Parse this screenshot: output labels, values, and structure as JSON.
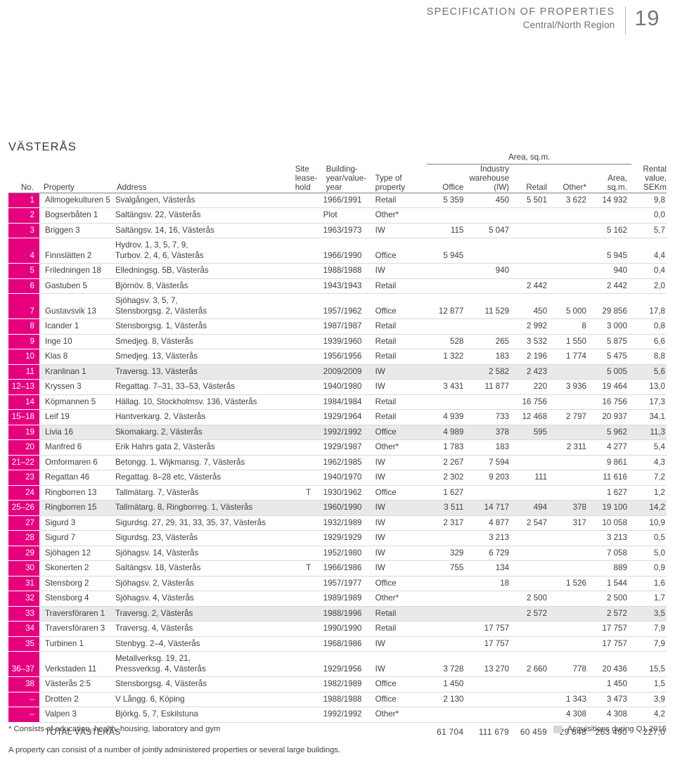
{
  "header": {
    "title": "SPECIFICATION OF PROPERTIES",
    "subtitle": "Central/North Region",
    "page_number": "19"
  },
  "city": "VÄSTERÅS",
  "table": {
    "group_header": "Area, sq.m.",
    "columns": {
      "no": "No.",
      "property": "Property",
      "address": "Address",
      "site_leasehold": "Site\nlease-\nhold",
      "building_year": "Building-\nyear/value-\nyear",
      "type_of_property": "Type of\nproperty",
      "office": "Office",
      "industry_warehouse": "Industry\nwarehouse\n(IW)",
      "retail": "Retail",
      "other": "Other*",
      "area_sqm": "Area,\nsq.m.",
      "rental_value": "Rental\nvalue,\nSEKm"
    },
    "rows": [
      {
        "no": "1",
        "property": "Allmogekulturen 5",
        "address": "Svalgången, Västerås",
        "address2": "",
        "site": "",
        "byear": "1966/1991",
        "type": "Retail",
        "office": "5 359",
        "iw": "450",
        "retail": "5 501",
        "other": "3 622",
        "area": "14 932",
        "rental": "9,8",
        "acq": false
      },
      {
        "no": "2",
        "property": "Bogserbåten 1",
        "address": "Saltängsv. 22, Västerås",
        "address2": "",
        "site": "",
        "byear": "Plot",
        "type": "Other*",
        "office": "",
        "iw": "",
        "retail": "",
        "other": "",
        "area": "",
        "rental": "0,0",
        "acq": false
      },
      {
        "no": "3",
        "property": "Briggen 3",
        "address": "Saltängsv. 14, 16, Västerås",
        "address2": "",
        "site": "",
        "byear": "1963/1973",
        "type": "IW",
        "office": "115",
        "iw": "5 047",
        "retail": "",
        "other": "",
        "area": "5 162",
        "rental": "5,7",
        "acq": false
      },
      {
        "no": "4",
        "property": "Finnslätten 2",
        "address": "Hydrov. 1, 3, 5, 7, 9,",
        "address2": "Turbov. 2, 4, 6, Västerås",
        "site": "",
        "byear": "1966/1990",
        "type": "Office",
        "office": "5 945",
        "iw": "",
        "retail": "",
        "other": "",
        "area": "5 945",
        "rental": "4,4",
        "acq": false
      },
      {
        "no": "5",
        "property": "Friledningen 18",
        "address": "Elledningsg. 5B, Västerås",
        "address2": "",
        "site": "",
        "byear": "1988/1988",
        "type": "IW",
        "office": "",
        "iw": "940",
        "retail": "",
        "other": "",
        "area": "940",
        "rental": "0,4",
        "acq": false
      },
      {
        "no": "6",
        "property": "Gastuben 5",
        "address": "Björnöv. 8, Västerås",
        "address2": "",
        "site": "",
        "byear": "1943/1943",
        "type": "Retail",
        "office": "",
        "iw": "",
        "retail": "2 442",
        "other": "",
        "area": "2 442",
        "rental": "2,0",
        "acq": false
      },
      {
        "no": "7",
        "property": "Gustavsvik 13",
        "address": "Sjöhagsv. 3, 5, 7,",
        "address2": "Stensborgsg. 2, Västerås",
        "site": "",
        "byear": "1957/1962",
        "type": "Office",
        "office": "12 877",
        "iw": "11 529",
        "retail": "450",
        "other": "5 000",
        "area": "29 856",
        "rental": "17,8",
        "acq": false
      },
      {
        "no": "8",
        "property": "Icander 1",
        "address": "Stensborgsg. 1, Västerås",
        "address2": "",
        "site": "",
        "byear": "1987/1987",
        "type": "Retail",
        "office": "",
        "iw": "",
        "retail": "2 992",
        "other": "8",
        "area": "3 000",
        "rental": "0,8",
        "acq": false
      },
      {
        "no": "9",
        "property": "Inge 10",
        "address": "Smedjeg. 8, Västerås",
        "address2": "",
        "site": "",
        "byear": "1939/1960",
        "type": "Retail",
        "office": "528",
        "iw": "265",
        "retail": "3 532",
        "other": "1 550",
        "area": "5 875",
        "rental": "6,6",
        "acq": false
      },
      {
        "no": "10",
        "property": "Klas 8",
        "address": "Smedjeg. 13, Västerås",
        "address2": "",
        "site": "",
        "byear": "1956/1956",
        "type": "Retail",
        "office": "1 322",
        "iw": "183",
        "retail": "2 196",
        "other": "1 774",
        "area": "5 475",
        "rental": "8,8",
        "acq": false
      },
      {
        "no": "11",
        "property": "Kranlinan 1",
        "address": "Traversg. 13, Västerås",
        "address2": "",
        "site": "",
        "byear": "2009/2009",
        "type": "IW",
        "office": "",
        "iw": "2 582",
        "retail": "2 423",
        "other": "",
        "area": "5 005",
        "rental": "5,6",
        "acq": true
      },
      {
        "no": "12–13",
        "property": "Kryssen 3",
        "address": "Regattag. 7–31, 33–53, Västerås",
        "address2": "",
        "site": "",
        "byear": "1940/1980",
        "type": "IW",
        "office": "3 431",
        "iw": "11 877",
        "retail": "220",
        "other": "3 936",
        "area": "19 464",
        "rental": "13,0",
        "acq": false
      },
      {
        "no": "14",
        "property": "Köpmannen 5",
        "address": "Hällag. 10, Stockholmsv. 136, Västerås",
        "address2": "",
        "site": "",
        "byear": "1984/1984",
        "type": "Retail",
        "office": "",
        "iw": "",
        "retail": "16 756",
        "other": "",
        "area": "16 756",
        "rental": "17,3",
        "acq": false
      },
      {
        "no": "15–18",
        "property": "Leif 19",
        "address": "Hantverkarg. 2, Västerås",
        "address2": "",
        "site": "",
        "byear": "1929/1964",
        "type": "Retail",
        "office": "4 939",
        "iw": "733",
        "retail": "12 468",
        "other": "2 797",
        "area": "20 937",
        "rental": "34,1",
        "acq": false
      },
      {
        "no": "19",
        "property": "Livia 16",
        "address": "Skomakarg. 2, Västerås",
        "address2": "",
        "site": "",
        "byear": "1992/1992",
        "type": "Office",
        "office": "4 989",
        "iw": "378",
        "retail": "595",
        "other": "",
        "area": "5 962",
        "rental": "11,3",
        "acq": true
      },
      {
        "no": "20",
        "property": "Manfred 6",
        "address": "Erik Hahrs gata 2, Västerås",
        "address2": "",
        "site": "",
        "byear": "1929/1987",
        "type": "Other*",
        "office": "1 783",
        "iw": "183",
        "retail": "",
        "other": "2 311",
        "area": "4 277",
        "rental": "5,4",
        "acq": false
      },
      {
        "no": "21–22",
        "property": "Omformaren 6",
        "address": "Betongg. 1, Wijkmansg. 7, Västerås",
        "address2": "",
        "site": "",
        "byear": "1962/1985",
        "type": "IW",
        "office": "2 267",
        "iw": "7 594",
        "retail": "",
        "other": "",
        "area": "9 861",
        "rental": "4,3",
        "acq": false
      },
      {
        "no": "23",
        "property": "Regattan 46",
        "address": "Regattag. 8–28 etc, Västerås",
        "address2": "",
        "site": "",
        "byear": "1940/1970",
        "type": "IW",
        "office": "2 302",
        "iw": "9 203",
        "retail": "111",
        "other": "",
        "area": "11 616",
        "rental": "7,2",
        "acq": false
      },
      {
        "no": "24",
        "property": "Ringborren 13",
        "address": "Tallmätarg. 7, Västerås",
        "address2": "",
        "site": "T",
        "byear": "1930/1962",
        "type": "Office",
        "office": "1 627",
        "iw": "",
        "retail": "",
        "other": "",
        "area": "1 627",
        "rental": "1,2",
        "acq": false
      },
      {
        "no": "25–26",
        "property": "Ringborren 15",
        "address": "Tallmätarg. 8, Ringborreg. 1, Västerås",
        "address2": "",
        "site": "",
        "byear": "1960/1990",
        "type": "IW",
        "office": "3 511",
        "iw": "14 717",
        "retail": "494",
        "other": "378",
        "area": "19 100",
        "rental": "14,2",
        "acq": true
      },
      {
        "no": "27",
        "property": "Sigurd 3",
        "address": "Sigurdsg. 27, 29, 31, 33, 35, 37, Västerås",
        "address2": "",
        "site": "",
        "byear": "1932/1989",
        "type": "IW",
        "office": "2 317",
        "iw": "4 877",
        "retail": "2 547",
        "other": "317",
        "area": "10 058",
        "rental": "10,9",
        "acq": false
      },
      {
        "no": "28",
        "property": "Sigurd 7",
        "address": "Sigurdsg. 23, Västerås",
        "address2": "",
        "site": "",
        "byear": "1929/1929",
        "type": "IW",
        "office": "",
        "iw": "3 213",
        "retail": "",
        "other": "",
        "area": "3 213",
        "rental": "0,5",
        "acq": false
      },
      {
        "no": "29",
        "property": "Sjöhagen 12",
        "address": "Sjöhagsv. 14, Västerås",
        "address2": "",
        "site": "",
        "byear": "1952/1980",
        "type": "IW",
        "office": "329",
        "iw": "6 729",
        "retail": "",
        "other": "",
        "area": "7 058",
        "rental": "5,0",
        "acq": false
      },
      {
        "no": "30",
        "property": "Skonerten 2",
        "address": "Saltängsv. 18, Västerås",
        "address2": "",
        "site": "T",
        "byear": "1966/1986",
        "type": "IW",
        "office": "755",
        "iw": "134",
        "retail": "",
        "other": "",
        "area": "889",
        "rental": "0,9",
        "acq": false
      },
      {
        "no": "31",
        "property": "Stensborg 2",
        "address": "Sjöhagsv. 2, Västerås",
        "address2": "",
        "site": "",
        "byear": "1957/1977",
        "type": "Office",
        "office": "",
        "iw": "18",
        "retail": "",
        "other": "1 526",
        "area": "1 544",
        "rental": "1,6",
        "acq": false
      },
      {
        "no": "32",
        "property": "Stensborg 4",
        "address": "Sjöhagsv. 4, Västerås",
        "address2": "",
        "site": "",
        "byear": "1989/1989",
        "type": "Other*",
        "office": "",
        "iw": "",
        "retail": "2 500",
        "other": "",
        "area": "2 500",
        "rental": "1,7",
        "acq": false
      },
      {
        "no": "33",
        "property": "Traversföraren 1",
        "address": "Traversg. 2, Västerås",
        "address2": "",
        "site": "",
        "byear": "1988/1996",
        "type": "Retail",
        "office": "",
        "iw": "",
        "retail": "2 572",
        "other": "",
        "area": "2 572",
        "rental": "3,5",
        "acq": true
      },
      {
        "no": "34",
        "property": "Traversföraren 3",
        "address": "Traversg. 4, Västerås",
        "address2": "",
        "site": "",
        "byear": "1990/1990",
        "type": "Retail",
        "office": "",
        "iw": "17 757",
        "retail": "",
        "other": "",
        "area": "17 757",
        "rental": "7,9",
        "acq": false
      },
      {
        "no": "35",
        "property": "Turbinen 1",
        "address": "Stenbyg. 2–4, Västerås",
        "address2": "",
        "site": "",
        "byear": "1968/1986",
        "type": "IW",
        "office": "",
        "iw": "17 757",
        "retail": "",
        "other": "",
        "area": "17 757",
        "rental": "7,9",
        "acq": false
      },
      {
        "no": "36–37",
        "property": "Verkstaden 11",
        "address": "Metallverksg. 19, 21,",
        "address2": "Pressverksg. 4, Västerås",
        "site": "",
        "byear": "1929/1956",
        "type": "IW",
        "office": "3 728",
        "iw": "13 270",
        "retail": "2 660",
        "other": "778",
        "area": "20 436",
        "rental": "15,5",
        "acq": false
      },
      {
        "no": "38",
        "property": "Västerås 2:5",
        "address": "Stensborgsg. 4, Västerås",
        "address2": "",
        "site": "",
        "byear": "1982/1989",
        "type": "Office",
        "office": "1 450",
        "iw": "",
        "retail": "",
        "other": "",
        "area": "1 450",
        "rental": "1,5",
        "acq": false
      },
      {
        "no": "–",
        "property": "Drotten 2",
        "address": "V Långg. 6, Köping",
        "address2": "",
        "site": "",
        "byear": "1988/1988",
        "type": "Office",
        "office": "2 130",
        "iw": "",
        "retail": "",
        "other": "1 343",
        "area": "3 473",
        "rental": "3,9",
        "acq": false
      },
      {
        "no": "–",
        "property": "Valpen 3",
        "address": "Björkg. 5, 7, Eskilstuna",
        "address2": "",
        "site": "",
        "byear": "1992/1992",
        "type": "Other*",
        "office": "",
        "iw": "",
        "retail": "",
        "other": "4 308",
        "area": "4 308",
        "rental": "4,2",
        "acq": false
      }
    ],
    "total": {
      "label": "TOTAL VÄSTERÅS",
      "office": "61 704",
      "iw": "111 679",
      "retail": "60 459",
      "other": "29 648",
      "area": "263 490",
      "rental": "227,0"
    }
  },
  "footnotes": {
    "asterisk": "* Consists of education, health, housing, laboratory and gym",
    "legend": "Acquisitions during Q1 2015",
    "note": "A property can consist of a number of jointly administered properties or several large buildings."
  },
  "colors": {
    "accent_pink": "#e6007e",
    "acquisition_gray": "#e8e9ea",
    "text": "#3f4042"
  }
}
